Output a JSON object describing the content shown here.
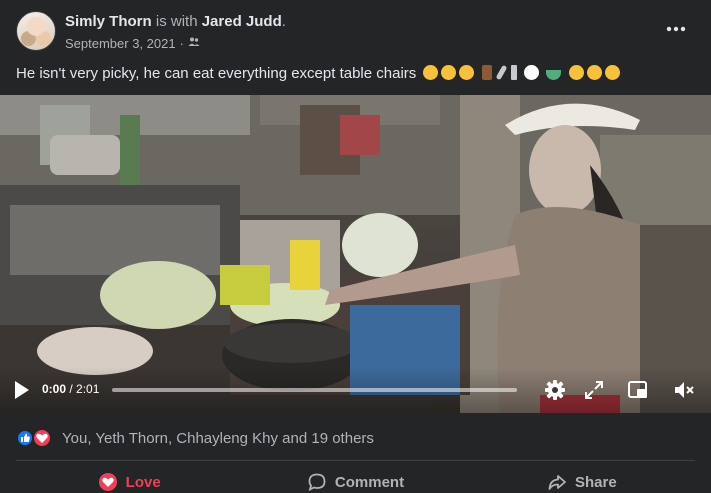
{
  "post": {
    "author": "Simly Thorn",
    "with_text": "is with",
    "tagged": "Jared Judd",
    "period": ".",
    "date": "September 3, 2021",
    "dot": "·",
    "audience_icon": "friends-icon",
    "caption": "He isn't very picky, he can eat everything except table chairs",
    "caption_emojis": [
      "rofl",
      "laughing",
      "grin-sweat",
      "chair",
      "spoon",
      "fork-knife",
      "plate",
      "bowl",
      "rofl",
      "grin-sweat",
      "laughing"
    ]
  },
  "video": {
    "current_time": "0:00",
    "separator": " / ",
    "duration": "2:01",
    "progress": 0
  },
  "reactions": {
    "types": [
      "like",
      "love"
    ],
    "summary": "You, Yeth Thorn, Chhayleng Khy and 19 others"
  },
  "actions": {
    "love_label": "Love",
    "comment_label": "Comment",
    "share_label": "Share"
  },
  "colors": {
    "background": "#242526",
    "text_primary": "#e4e6eb",
    "text_secondary": "#b0b3b8",
    "love": "#f33e58",
    "like": "#1877f2"
  }
}
